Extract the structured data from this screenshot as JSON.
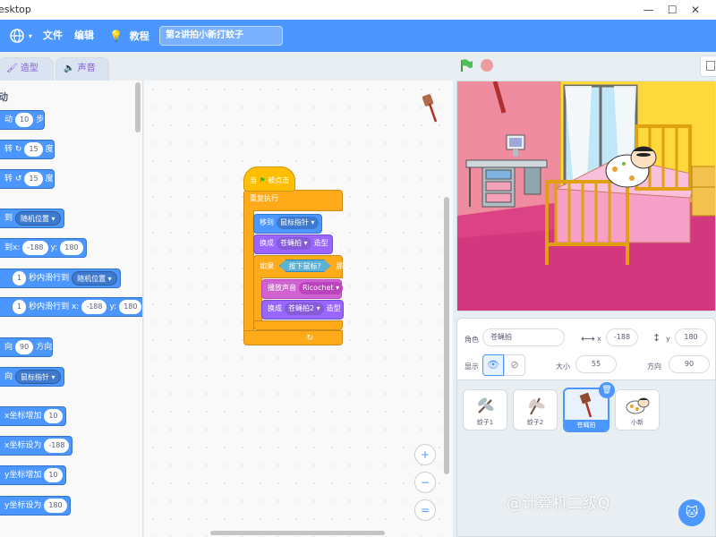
{
  "window": {
    "title": "esktop"
  },
  "menubar": {
    "file": "文件",
    "edit": "编辑",
    "tutorials": "教程",
    "project_title": "第2讲拍小新打蚊子"
  },
  "tabs": {
    "costumes": "造型",
    "sounds": "声音"
  },
  "palette": {
    "category": "动",
    "move": {
      "label": "动",
      "steps_value": "10",
      "unit": "步"
    },
    "turn_right": {
      "label": "转",
      "value": "15",
      "unit": "度"
    },
    "turn_left": {
      "label": "转",
      "value": "15",
      "unit": "度"
    },
    "goto": {
      "label": "到",
      "target": "随机位置"
    },
    "goto_xy": {
      "label": "到x:",
      "x": "-188",
      "y_label": "y:",
      "y": "180"
    },
    "glide": {
      "secs": "1",
      "label": "秒内滑行到",
      "target": "随机位置"
    },
    "glide_xy": {
      "secs": "1",
      "label": "秒内滑行到 x:",
      "x": "-188",
      "y_label": "y:",
      "y": "180"
    },
    "point_dir": {
      "label": "向",
      "value": "90",
      "unit": "方向"
    },
    "point_towards": {
      "label": "向",
      "target": "鼠标指针"
    },
    "change_x": {
      "label": "x坐标增加",
      "value": "10"
    },
    "set_x": {
      "label": "x坐标设为",
      "value": "-188"
    },
    "change_y": {
      "label": "y坐标增加",
      "value": "10"
    },
    "set_y": {
      "label": "y坐标设为",
      "value": "180"
    }
  },
  "script": {
    "hat": {
      "prefix": "当",
      "suffix": "被点击"
    },
    "forever": "重复执行",
    "goto": {
      "label": "移到",
      "target": "鼠标指针"
    },
    "switch1": {
      "label": "换成",
      "costume": "苍蝇拍",
      "suffix": "造型"
    },
    "if": {
      "label": "如果",
      "condition": "按下鼠标?",
      "then": "那么"
    },
    "play_sound": {
      "label": "播放声音",
      "sound": "Ricochet"
    },
    "switch2": {
      "label": "换成",
      "costume": "苍蝇拍2",
      "suffix": "造型"
    }
  },
  "zoom": {
    "in": "+",
    "out": "−",
    "reset": "="
  },
  "sprite_info": {
    "sprite_label": "角色",
    "sprite_name": "苍蝇拍",
    "x_label": "x",
    "x_value": "-188",
    "y_label": "y",
    "y_value": "180",
    "show_label": "显示",
    "size_label": "大小",
    "size_value": "55",
    "direction_label": "方向",
    "direction_value": "90"
  },
  "sprites": [
    {
      "name": "蚊子1",
      "icon": "mosquito-icon"
    },
    {
      "name": "蚊子2",
      "icon": "mosquito-icon"
    },
    {
      "name": "苍蝇拍",
      "icon": "flyswatter-icon",
      "selected": true
    },
    {
      "name": "小新",
      "icon": "shinchan-icon"
    }
  ],
  "watermark": "@计算机二级Q",
  "colors": {
    "menubar": "#4c97ff",
    "motion": "#4c97ff",
    "events": "#ffbf00",
    "control": "#ffab19",
    "looks": "#9966ff",
    "sound": "#cf63cf",
    "sensing": "#5cb1d6"
  }
}
